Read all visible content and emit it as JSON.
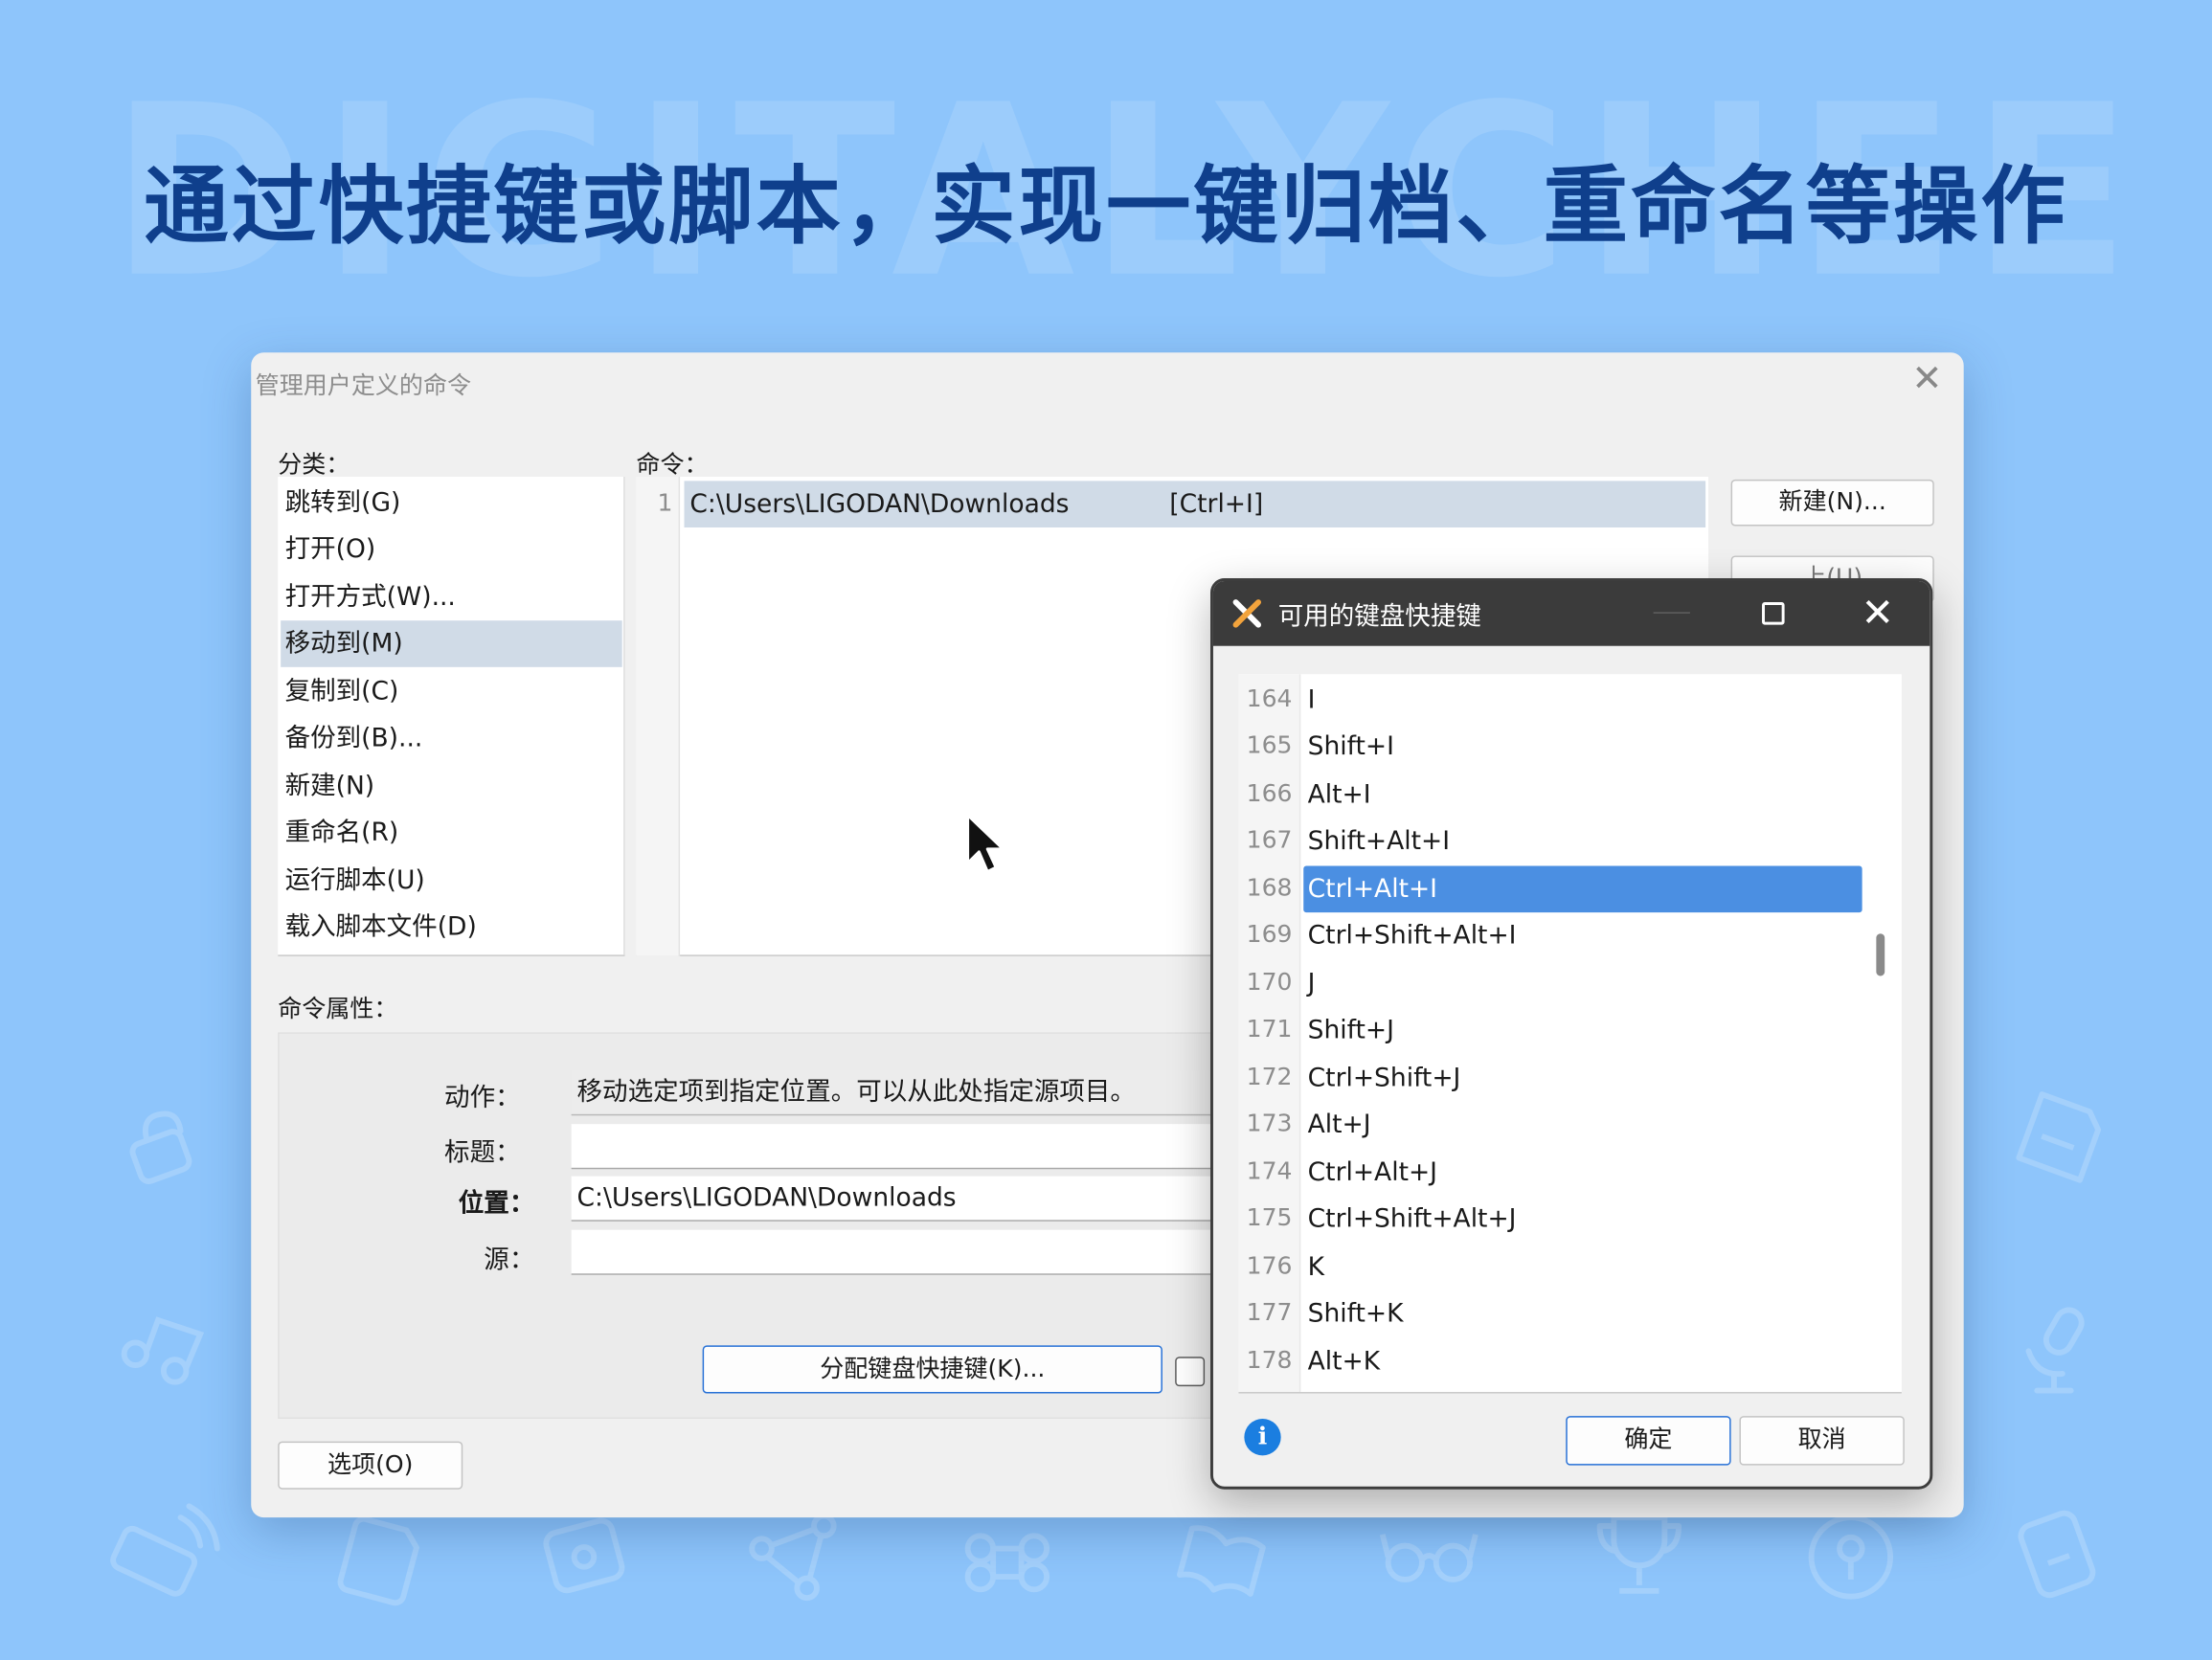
{
  "hero": {
    "watermark": "DIGITALYCHEE",
    "headline": "通过快捷键或脚本，实现一键归档、重命名等操作"
  },
  "main_dialog": {
    "title": "管理用户定义的命令",
    "category_label": "分类：",
    "categories": [
      {
        "label": "跳转到(G)"
      },
      {
        "label": "打开(O)"
      },
      {
        "label": "打开方式(W)..."
      },
      {
        "label": "移动到(M)",
        "selected": true
      },
      {
        "label": "复制到(C)"
      },
      {
        "label": "备份到(B)..."
      },
      {
        "label": "新建(N)"
      },
      {
        "label": "重命名(R)"
      },
      {
        "label": "运行脚本(U)"
      },
      {
        "label": "载入脚本文件(D)"
      }
    ],
    "command_label": "命令：",
    "commands": [
      {
        "index": "1",
        "path": "C:\\Users\\LIGODAN\\Downloads",
        "shortcut": "[Ctrl+I]"
      }
    ],
    "new_button": "新建(N)...",
    "up_button": "上(U)",
    "properties_label": "命令属性：",
    "properties": {
      "action_label": "动作：",
      "action_value": "移动选定项到指定位置。可以从此处指定源项目。",
      "title_label": "标题：",
      "title_value": "",
      "location_label": "位置：",
      "location_value": "C:\\Users\\LIGODAN\\Downloads",
      "source_label": "源：",
      "source_value": ""
    },
    "assign_shortcut_button": "分配键盘快捷键(K)...",
    "options_button": "选项(O)"
  },
  "shortcut_dialog": {
    "title": "可用的键盘快捷键",
    "items": [
      {
        "n": "164",
        "key": "I"
      },
      {
        "n": "165",
        "key": "Shift+I"
      },
      {
        "n": "166",
        "key": "Alt+I"
      },
      {
        "n": "167",
        "key": "Shift+Alt+I"
      },
      {
        "n": "168",
        "key": "Ctrl+Alt+I",
        "selected": true
      },
      {
        "n": "169",
        "key": "Ctrl+Shift+Alt+I"
      },
      {
        "n": "170",
        "key": "J"
      },
      {
        "n": "171",
        "key": "Shift+J"
      },
      {
        "n": "172",
        "key": "Ctrl+Shift+J"
      },
      {
        "n": "173",
        "key": "Alt+J"
      },
      {
        "n": "174",
        "key": "Ctrl+Alt+J"
      },
      {
        "n": "175",
        "key": "Ctrl+Shift+Alt+J"
      },
      {
        "n": "176",
        "key": "K"
      },
      {
        "n": "177",
        "key": "Shift+K"
      },
      {
        "n": "178",
        "key": "Alt+K"
      }
    ],
    "ok_button": "确定",
    "cancel_button": "取消",
    "info_icon": "info-icon"
  },
  "colors": {
    "background": "#8ec5fb",
    "headline": "#0f3f8c",
    "selection": "#4b8fe2",
    "list_selection": "#d0dbe7"
  }
}
